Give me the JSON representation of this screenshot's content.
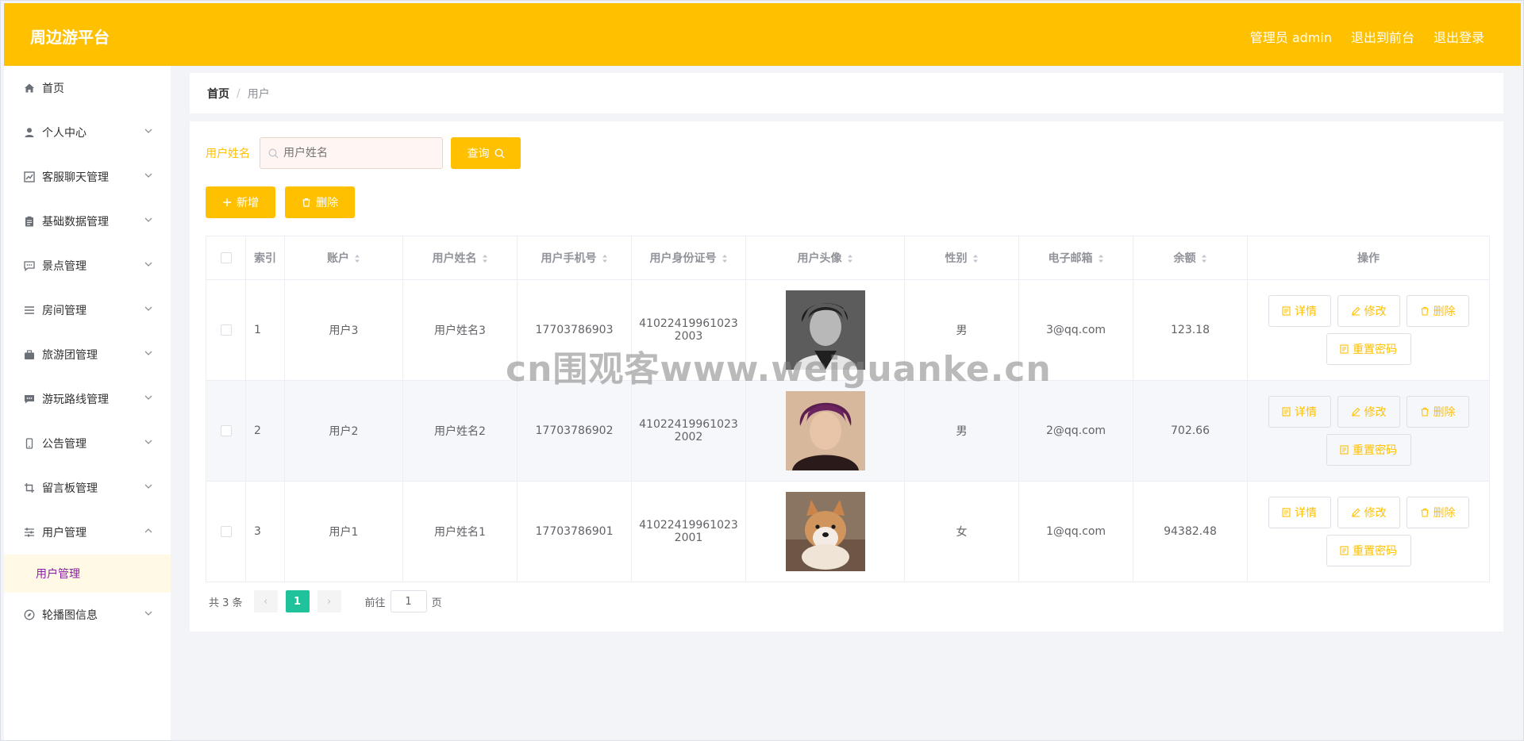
{
  "header": {
    "brand": "周边游平台",
    "admin_label": "管理员 admin",
    "to_front": "退出到前台",
    "logout": "退出登录"
  },
  "sidebar": {
    "items": [
      {
        "label": "首页",
        "icon": "home-icon"
      },
      {
        "label": "个人中心",
        "icon": "user-icon"
      },
      {
        "label": "客服聊天管理",
        "icon": "chart-icon"
      },
      {
        "label": "基础数据管理",
        "icon": "clipboard-icon"
      },
      {
        "label": "景点管理",
        "icon": "chat-icon"
      },
      {
        "label": "房间管理",
        "icon": "list-icon"
      },
      {
        "label": "旅游团管理",
        "icon": "briefcase-icon"
      },
      {
        "label": "游玩路线管理",
        "icon": "message-icon"
      },
      {
        "label": "公告管理",
        "icon": "phone-icon"
      },
      {
        "label": "留言板管理",
        "icon": "crop-icon"
      },
      {
        "label": "用户管理",
        "icon": "sliders-icon"
      },
      {
        "label": "轮播图信息",
        "icon": "compass-icon"
      }
    ],
    "active_sub": "用户管理"
  },
  "breadcrumb": {
    "home": "首页",
    "sep": "/",
    "current": "用户"
  },
  "search": {
    "label": "用户姓名",
    "placeholder": "用户姓名",
    "button": "查询"
  },
  "actions": {
    "add": "新增",
    "delete": "删除"
  },
  "table": {
    "headers": [
      "索引",
      "账户",
      "用户姓名",
      "用户手机号",
      "用户身份证号",
      "用户头像",
      "性别",
      "电子邮箱",
      "余额",
      "操作"
    ],
    "rows": [
      {
        "index": "1",
        "account": "用户3",
        "name": "用户姓名3",
        "phone": "17703786903",
        "id_line1": "41022419961023",
        "id_line2": "2003",
        "gender": "男",
        "email": "3@qq.com",
        "balance": "123.18"
      },
      {
        "index": "2",
        "account": "用户2",
        "name": "用户姓名2",
        "phone": "17703786902",
        "id_line1": "41022419961023",
        "id_line2": "2002",
        "gender": "男",
        "email": "2@qq.com",
        "balance": "702.66"
      },
      {
        "index": "3",
        "account": "用户1",
        "name": "用户姓名1",
        "phone": "17703786901",
        "id_line1": "41022419961023",
        "id_line2": "2001",
        "gender": "女",
        "email": "1@qq.com",
        "balance": "94382.48"
      }
    ],
    "op_labels": {
      "detail": "详情",
      "edit": "修改",
      "delete": "删除",
      "reset": "重置密码"
    }
  },
  "pager": {
    "total": "共 3 条",
    "prev": "‹",
    "current": "1",
    "next": "›",
    "goto_prefix": "前往",
    "goto_value": "1",
    "goto_suffix": "页"
  },
  "watermark": "cn围观客www.weiguanke.cn",
  "colors": {
    "accent": "#ffc000",
    "pager_active": "#1fc29b",
    "submenu_text": "#8c1ea5"
  }
}
